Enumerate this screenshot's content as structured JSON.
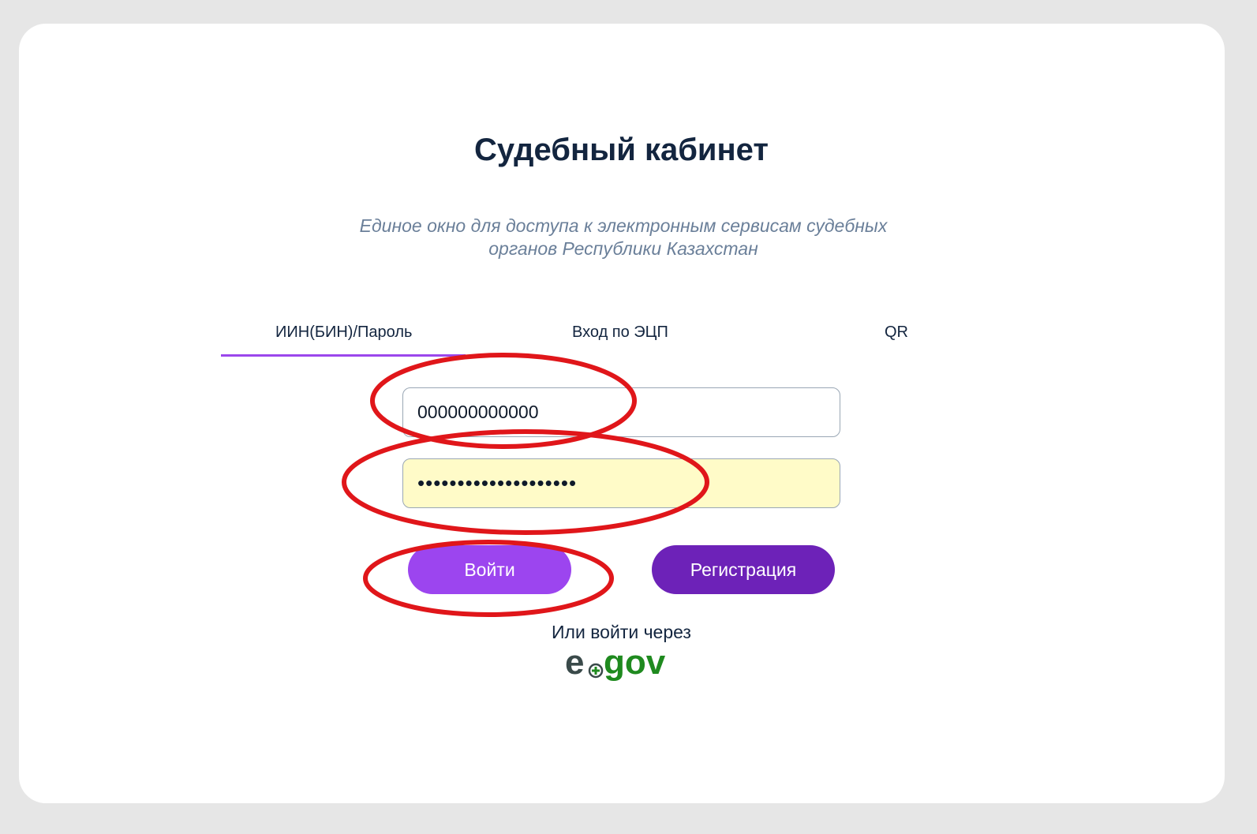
{
  "page": {
    "title": "Судебный кабинет",
    "subtitle_line1": "Единое окно для доступа к электронным сервисам судебных",
    "subtitle_line2": "органов Республики Казахстан"
  },
  "tabs": [
    {
      "label": "ИИН(БИН)/Пароль",
      "active": true
    },
    {
      "label": "Вход по ЭЦП",
      "active": false
    },
    {
      "label": "QR",
      "active": false
    }
  ],
  "form": {
    "iin_value": "000000000000",
    "password_value": "••••••••••••••••••••"
  },
  "buttons": {
    "login_label": "Войти",
    "register_label": "Регистрация"
  },
  "alt_login": {
    "text": "Или войти через",
    "logo_prefix": "e",
    "logo_suffix": "gov"
  },
  "colors": {
    "accent": "#9b47ec",
    "login_button": "#9c45ef",
    "register_button": "#6d22b8",
    "title": "#13253f",
    "annotation": "#e0161a",
    "logo_dark": "#3a4a4a",
    "logo_green": "#1f8a1f"
  }
}
